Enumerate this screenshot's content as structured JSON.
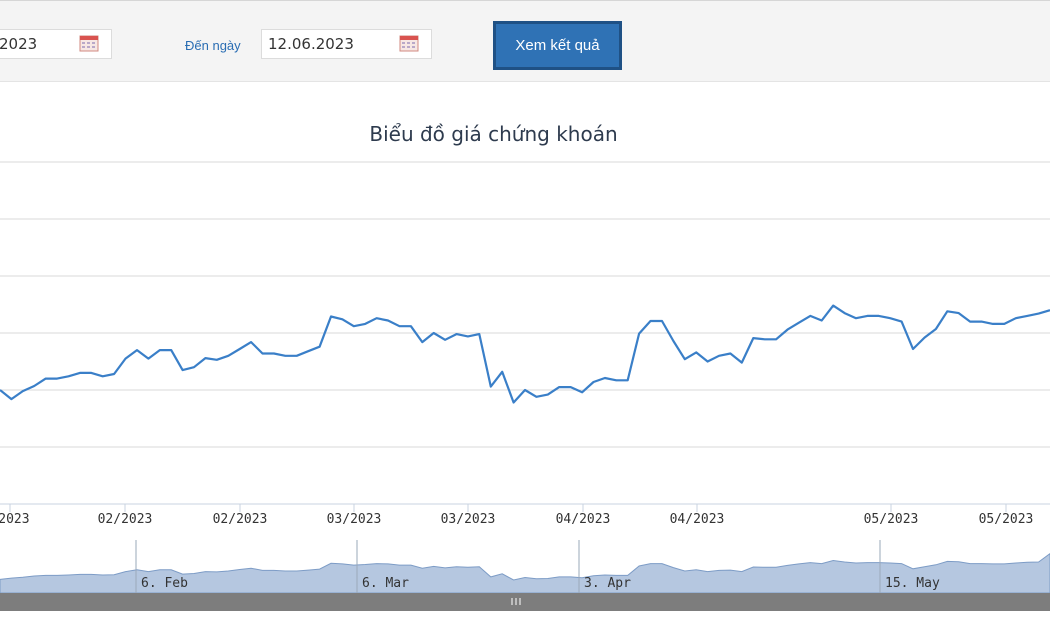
{
  "toolbar": {
    "from_date_partial": "2023",
    "to_label": "Đến ngày",
    "to_date": "12.06.2023",
    "submit_label": "Xem kết quả"
  },
  "colors": {
    "line": "#3a7fc8",
    "navigator_fill": "#b5c7e0",
    "button": "#2f72b5",
    "button_border": "#1f5185"
  },
  "chart_data": {
    "type": "line",
    "title": "Biểu đồ giá chứng khoán",
    "x_tick_labels": [
      "/2023",
      "02/2023",
      "02/2023",
      "03/2023",
      "03/2023",
      "04/2023",
      "04/2023",
      "05/2023",
      "05/2023"
    ],
    "navigator_labels": [
      "6. Feb",
      "6. Mar",
      "3. Apr",
      "15. May"
    ],
    "y_grid_lines": 7,
    "y_unit_note": "relative price level (axis labels not visible)",
    "series": [
      {
        "values": [
          20.0,
          18.4,
          19.8,
          20.7,
          22.0,
          22.0,
          22.4,
          23.0,
          23.0,
          22.4,
          22.8,
          25.5,
          27.0,
          25.5,
          27.0,
          27.0,
          23.5,
          24.0,
          25.6,
          25.3,
          26.0,
          27.2,
          28.4,
          26.4,
          26.4,
          26.0,
          26.0,
          26.8,
          27.6,
          32.9,
          32.4,
          31.2,
          31.6,
          32.6,
          32.2,
          31.2,
          31.2,
          28.4,
          30.0,
          28.8,
          29.8,
          29.4,
          29.8,
          20.6,
          23.2,
          17.8,
          20.0,
          18.8,
          19.2,
          20.5,
          20.5,
          19.6,
          21.4,
          22.1,
          21.7,
          21.7,
          29.9,
          32.1,
          32.1,
          28.6,
          25.4,
          26.6,
          25.0,
          26.0,
          26.4,
          24.8,
          29.1,
          28.9,
          28.9,
          30.6,
          31.8,
          33.0,
          32.2,
          34.8,
          33.5,
          32.6,
          33.0,
          33.0,
          32.6,
          32.0,
          27.2,
          29.2,
          30.7,
          33.8,
          33.5,
          32.0,
          32.0,
          31.6,
          31.6,
          32.6,
          33.0,
          33.4,
          34.0
        ]
      }
    ],
    "navigator_values": [
      0.2,
      0.6,
      0.9,
      1.3,
      1.5,
      1.5,
      1.6,
      1.8,
      1.8,
      1.6,
      1.7,
      2.7,
      3.3,
      2.7,
      3.3,
      3.3,
      1.9,
      2.1,
      2.7,
      2.6,
      2.9,
      3.4,
      3.8,
      3.1,
      3.1,
      2.9,
      2.9,
      3.2,
      3.5,
      5.4,
      5.2,
      4.8,
      5.0,
      5.3,
      5.2,
      4.8,
      4.8,
      3.8,
      4.4,
      3.9,
      4.3,
      4.1,
      4.3,
      1.0,
      2.0,
      0.0,
      0.8,
      0.4,
      0.5,
      1.0,
      1.0,
      0.7,
      1.4,
      1.6,
      1.5,
      1.5,
      4.5,
      5.3,
      5.3,
      4.0,
      2.9,
      3.3,
      2.7,
      3.1,
      3.2,
      2.7,
      4.2,
      4.1,
      4.1,
      4.7,
      5.2,
      5.6,
      5.3,
      6.3,
      5.8,
      5.5,
      5.6,
      5.6,
      5.5,
      5.3,
      3.6,
      4.3,
      4.9,
      6.0,
      5.9,
      5.3,
      5.3,
      5.2,
      5.2,
      5.5,
      5.7,
      5.8,
      8.5
    ]
  }
}
